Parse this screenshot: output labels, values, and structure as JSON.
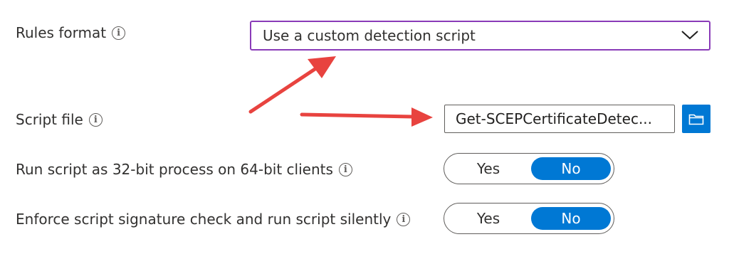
{
  "rules_format": {
    "label": "Rules format",
    "value": "Use a custom detection script"
  },
  "script_file": {
    "label": "Script file",
    "value": "Get-SCEPCertificateDetec..."
  },
  "run_32bit": {
    "label": "Run script as 32-bit process on 64-bit clients",
    "yes_label": "Yes",
    "no_label": "No",
    "selected": "No"
  },
  "enforce_signature": {
    "label": "Enforce script signature check and run script silently",
    "yes_label": "Yes",
    "no_label": "No",
    "selected": "No"
  },
  "icons": {
    "info": "info-icon",
    "dropdown": "chevron-down-icon",
    "browse": "folder-icon"
  },
  "colors": {
    "accent": "#0078d4",
    "dropdown_border": "#8a3bb8",
    "annotation_arrow": "#e8433f"
  }
}
